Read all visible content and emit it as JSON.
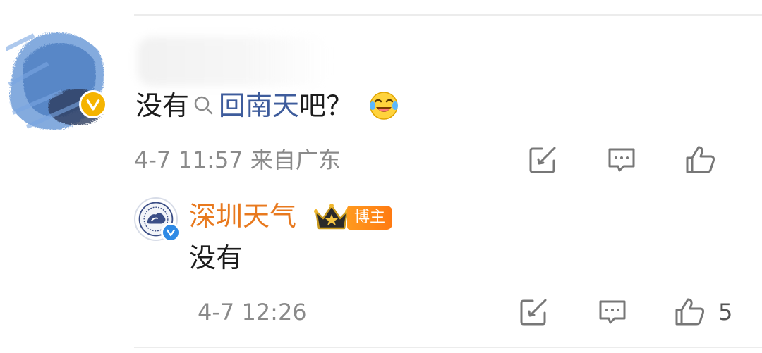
{
  "comment": {
    "text_before": "没有",
    "search_link": "回南天",
    "text_after": "吧？",
    "emoji": "laugh-cry-emoji",
    "time": "4-7 11:57",
    "location": "来自广东",
    "verified_color": "#f5b400"
  },
  "reply": {
    "author": "深圳天气",
    "badge": "博主",
    "text": "没有",
    "time": "4-7 12:26",
    "like_count": "5",
    "name_color": "#e8791e",
    "verified_color": "#2f8ae5"
  },
  "icons": {
    "repost": "repost-icon",
    "comment": "comment-icon",
    "like": "like-icon",
    "search": "search-icon"
  },
  "colors": {
    "link": "#3e5c9c",
    "meta": "#8a8a8a",
    "badge": "#ff8a18"
  }
}
